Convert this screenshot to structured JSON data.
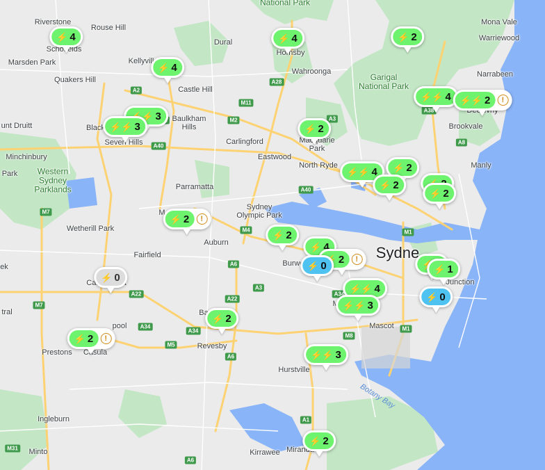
{
  "map": {
    "land_color": "#ebebeb",
    "water_color": "#8ab4f8",
    "park_color": "#c3e6c5",
    "road_color": "#fdd272"
  },
  "place_labels": [
    {
      "id": "riverstone",
      "text": "Riverstone"
    },
    {
      "id": "rouse-hill",
      "text": "Rouse Hill"
    },
    {
      "id": "schofields",
      "text": "Schofields"
    },
    {
      "id": "marsden-park",
      "text": "Marsden Park"
    },
    {
      "id": "kellyville",
      "text": "Kellyville"
    },
    {
      "id": "quakers-hill",
      "text": "Quakers Hill"
    },
    {
      "id": "castle-hill",
      "text": "Castle Hill"
    },
    {
      "id": "dural",
      "text": "Dural"
    },
    {
      "id": "hornsby",
      "text": "Hornsby"
    },
    {
      "id": "wahroonga",
      "text": "Wahroonga"
    },
    {
      "id": "mona-vale",
      "text": "Mona Vale"
    },
    {
      "id": "warriewood",
      "text": "Warriewood"
    },
    {
      "id": "narrabeen",
      "text": "Narrabeen"
    },
    {
      "id": "dee-why",
      "text": "Dee Why"
    },
    {
      "id": "brookvale",
      "text": "Brookvale"
    },
    {
      "id": "manly",
      "text": "Manly"
    },
    {
      "id": "mount-druitt",
      "text": "unt Druitt"
    },
    {
      "id": "blacktown",
      "text": "Blackto"
    },
    {
      "id": "seven-hills",
      "text": "Seven Hills"
    },
    {
      "id": "baulkham-hills",
      "text": "Baulkham\nHills"
    },
    {
      "id": "carlingford",
      "text": "Carlingford"
    },
    {
      "id": "eastwood",
      "text": "Eastwood"
    },
    {
      "id": "macquarie-park",
      "text": "Macquarie\nPark"
    },
    {
      "id": "north-ryde",
      "text": "North Ryde"
    },
    {
      "id": "minchinbury",
      "text": "Minchinbury"
    },
    {
      "id": "park-left",
      "text": "Park"
    },
    {
      "id": "parramatta",
      "text": "Parramatta"
    },
    {
      "id": "sydney-olympic-park",
      "text": "Sydney\nOlympic Park"
    },
    {
      "id": "wetherill-park",
      "text": "Wetherill Park"
    },
    {
      "id": "fairfield",
      "text": "Fairfield"
    },
    {
      "id": "auburn",
      "text": "Auburn"
    },
    {
      "id": "burwood",
      "text": "Burwo"
    },
    {
      "id": "sydney",
      "text": "Sydne"
    },
    {
      "id": "bondi-junction",
      "text": "Junction"
    },
    {
      "id": "ek",
      "text": "ek"
    },
    {
      "id": "cabramatta",
      "text": "Cabramatta"
    },
    {
      "id": "tral",
      "text": "tral"
    },
    {
      "id": "liverpool",
      "text": "pool"
    },
    {
      "id": "bankstown",
      "text": "Ba"
    },
    {
      "id": "marrickville",
      "text": "Mar"
    },
    {
      "id": "mascot",
      "text": "Mascot"
    },
    {
      "id": "prestons",
      "text": "Prestons"
    },
    {
      "id": "casula",
      "text": "Casula"
    },
    {
      "id": "revesby",
      "text": "Revesby"
    },
    {
      "id": "hurstville",
      "text": "Hurstville"
    },
    {
      "id": "rockdale",
      "text": "ale"
    },
    {
      "id": "ingleburn",
      "text": "Ingleburn"
    },
    {
      "id": "minto",
      "text": "Minto"
    },
    {
      "id": "kirrawee",
      "text": "Kirrawee"
    },
    {
      "id": "miranda",
      "text": "Miranda"
    },
    {
      "id": "m-pfx",
      "text": "M"
    }
  ],
  "park_labels": [
    {
      "id": "national-park-top",
      "text": "National Park"
    },
    {
      "id": "garigal",
      "text": "Garigal\nNational Park"
    },
    {
      "id": "western-sydney-parklands",
      "text": "Western\nSydney\nParklands"
    }
  ],
  "water_labels": [
    {
      "id": "botany-bay",
      "text": "Botany Bay"
    }
  ],
  "road_shields": [
    {
      "id": "a2-1",
      "text": "A2"
    },
    {
      "id": "a2-2",
      "text": "A2"
    },
    {
      "id": "m2-1",
      "text": "M2"
    },
    {
      "id": "m11",
      "text": "M11"
    },
    {
      "id": "a28",
      "text": "A28"
    },
    {
      "id": "a38",
      "text": "A38"
    },
    {
      "id": "a8",
      "text": "A8"
    },
    {
      "id": "a3-top",
      "text": "A3"
    },
    {
      "id": "a40-1",
      "text": "A40"
    },
    {
      "id": "a40-2",
      "text": "A40"
    },
    {
      "id": "m7-1",
      "text": "M7"
    },
    {
      "id": "m7-2",
      "text": "M7"
    },
    {
      "id": "m4",
      "text": "M4"
    },
    {
      "id": "a6-1",
      "text": "A6"
    },
    {
      "id": "a3-mid",
      "text": "A3"
    },
    {
      "id": "a22-1",
      "text": "A22"
    },
    {
      "id": "a22-2",
      "text": "A22"
    },
    {
      "id": "a34-1",
      "text": "A34"
    },
    {
      "id": "a34-2",
      "text": "A34"
    },
    {
      "id": "a34-3",
      "text": "A34"
    },
    {
      "id": "m5",
      "text": "M5"
    },
    {
      "id": "a6-2",
      "text": "A6"
    },
    {
      "id": "m8",
      "text": "M8"
    },
    {
      "id": "m1-1",
      "text": "M1"
    },
    {
      "id": "m1-2",
      "text": "M1"
    },
    {
      "id": "a1",
      "text": "A1"
    },
    {
      "id": "m31",
      "text": "M31"
    },
    {
      "id": "a6-3",
      "text": "A6"
    }
  ],
  "chargers": [
    {
      "id": "schofields",
      "count": "4",
      "status": "available",
      "warning": false
    },
    {
      "id": "kellyville",
      "count": "4",
      "status": "available",
      "warning": false
    },
    {
      "id": "hornsby",
      "count": "4",
      "status": "available",
      "warning": false
    },
    {
      "id": "terrey-hills",
      "count": "2",
      "status": "available",
      "warning": false
    },
    {
      "id": "frenchs-forest",
      "count": "4",
      "status": "available",
      "warning": false
    },
    {
      "id": "dee-why",
      "count": "2",
      "status": "available",
      "warning": true
    },
    {
      "id": "blacktown-a",
      "count": "3",
      "status": "available",
      "warning": false
    },
    {
      "id": "blacktown-b",
      "count": "3",
      "status": "available",
      "warning": false
    },
    {
      "id": "macquarie-park",
      "count": "2",
      "status": "available",
      "warning": false
    },
    {
      "id": "chatswood-a",
      "count": "4",
      "status": "available",
      "warning": false
    },
    {
      "id": "chatswood-b",
      "count": "2",
      "status": "available",
      "warning": false
    },
    {
      "id": "chatswood-c",
      "count": "2",
      "status": "available",
      "warning": false
    },
    {
      "id": "mosman-a",
      "count": "2",
      "status": "available",
      "warning": false
    },
    {
      "id": "mosman-b",
      "count": "2",
      "status": "available",
      "warning": false
    },
    {
      "id": "merrylands",
      "count": "2",
      "status": "available",
      "warning": true
    },
    {
      "id": "homebush",
      "count": "2",
      "status": "available",
      "warning": false
    },
    {
      "id": "burwood-a",
      "count": "4",
      "status": "available",
      "warning": false
    },
    {
      "id": "burwood-b",
      "count": "2",
      "status": "available",
      "warning": true
    },
    {
      "id": "burwood-c",
      "count": "0",
      "status": "in-use",
      "warning": false
    },
    {
      "id": "bondi-a",
      "count": "1",
      "status": "available",
      "warning": false
    },
    {
      "id": "bondi-b",
      "count": "1",
      "status": "available",
      "warning": false
    },
    {
      "id": "bondi-c",
      "count": "0",
      "status": "in-use",
      "warning": false
    },
    {
      "id": "cabramatta",
      "count": "0",
      "status": "offline",
      "warning": false
    },
    {
      "id": "marrickville-a",
      "count": "4",
      "status": "available",
      "warning": false
    },
    {
      "id": "marrickville-b",
      "count": "3",
      "status": "available",
      "warning": false
    },
    {
      "id": "bankstown",
      "count": "2",
      "status": "available",
      "warning": false
    },
    {
      "id": "liverpool",
      "count": "2",
      "status": "available",
      "warning": true
    },
    {
      "id": "rockdale",
      "count": "3",
      "status": "available",
      "warning": false
    },
    {
      "id": "miranda",
      "count": "2",
      "status": "available",
      "warning": false
    }
  ],
  "icons": {
    "charge": "⚡",
    "charge_double": "⚡⚡",
    "warning": "!"
  }
}
